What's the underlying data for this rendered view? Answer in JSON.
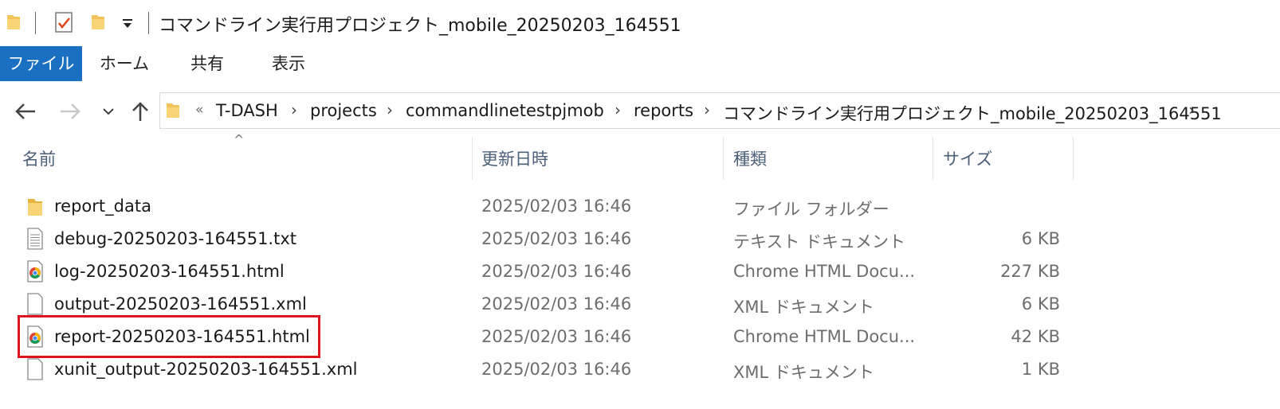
{
  "window": {
    "title": "コマンドライン実行用プロジェクト_mobile_20250203_164551"
  },
  "ribbon": {
    "tabs": [
      {
        "label": "ファイル"
      },
      {
        "label": "ホーム"
      },
      {
        "label": "共有"
      },
      {
        "label": "表示"
      }
    ]
  },
  "address": {
    "overflow": "«",
    "crumbs": [
      "T-DASH",
      "projects",
      "commandlinetestpjmob",
      "reports",
      "コマンドライン実行用プロジェクト_mobile_20250203_164551"
    ]
  },
  "columns": {
    "name": "名前",
    "date": "更新日時",
    "type": "種類",
    "size": "サイズ"
  },
  "files": [
    {
      "name": "report_data",
      "date": "2025/02/03 16:46",
      "type": "ファイル フォルダー",
      "size": "",
      "icon": "folder-icon"
    },
    {
      "name": "debug-20250203-164551.txt",
      "date": "2025/02/03 16:46",
      "type": "テキスト ドキュメント",
      "size": "6 KB",
      "icon": "text-file-icon"
    },
    {
      "name": "log-20250203-164551.html",
      "date": "2025/02/03 16:46",
      "type": "Chrome HTML Docu...",
      "size": "227 KB",
      "icon": "chrome-icon"
    },
    {
      "name": "output-20250203-164551.xml",
      "date": "2025/02/03 16:46",
      "type": "XML ドキュメント",
      "size": "6 KB",
      "icon": "blank-file-icon"
    },
    {
      "name": "report-20250203-164551.html",
      "date": "2025/02/03 16:46",
      "type": "Chrome HTML Docu...",
      "size": "42 KB",
      "icon": "chrome-icon"
    },
    {
      "name": "xunit_output-20250203-164551.xml",
      "date": "2025/02/03 16:46",
      "type": "XML ドキュメント",
      "size": "1 KB",
      "icon": "blank-file-icon"
    }
  ],
  "colors": {
    "accent": "#1a6fc0",
    "highlight": "#e0141e",
    "folder": "#f3c35b"
  }
}
